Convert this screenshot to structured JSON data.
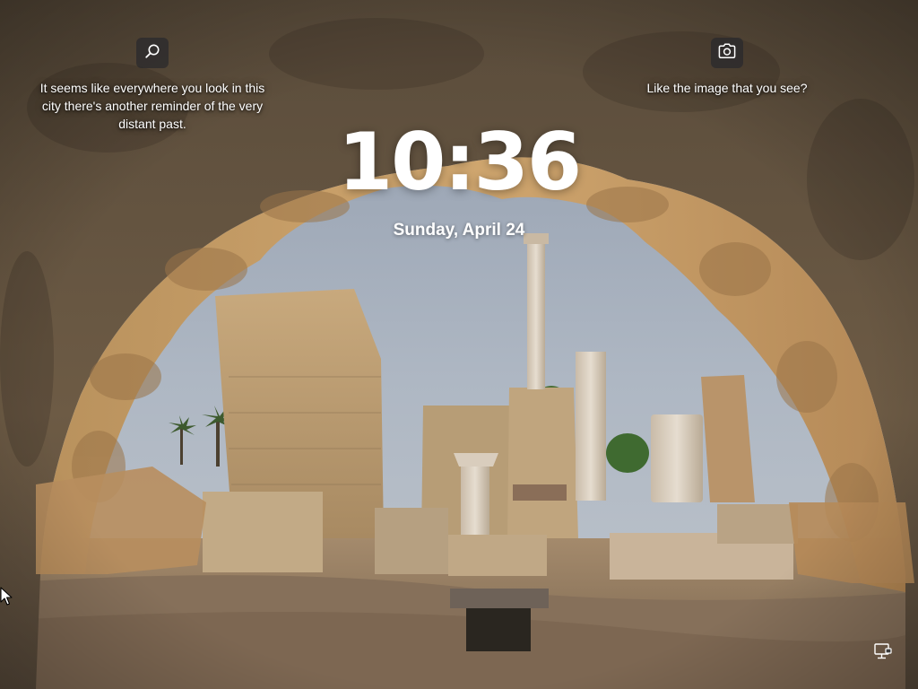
{
  "lock_screen": {
    "time": "10:36",
    "date": "Sunday, April 24"
  },
  "spotlight": {
    "search_icon": "search-icon",
    "fact_text": "It seems like everywhere you look in this city there's another reminder of the very distant past.",
    "camera_icon": "camera-icon",
    "like_prompt": "Like the image that you see?"
  },
  "status": {
    "network_icon": "network-ethernet-icon"
  },
  "colors": {
    "text": "#ffffff",
    "button_bg": "#28282c",
    "sky": "#a7b1bf",
    "stone": "#c49a63"
  }
}
